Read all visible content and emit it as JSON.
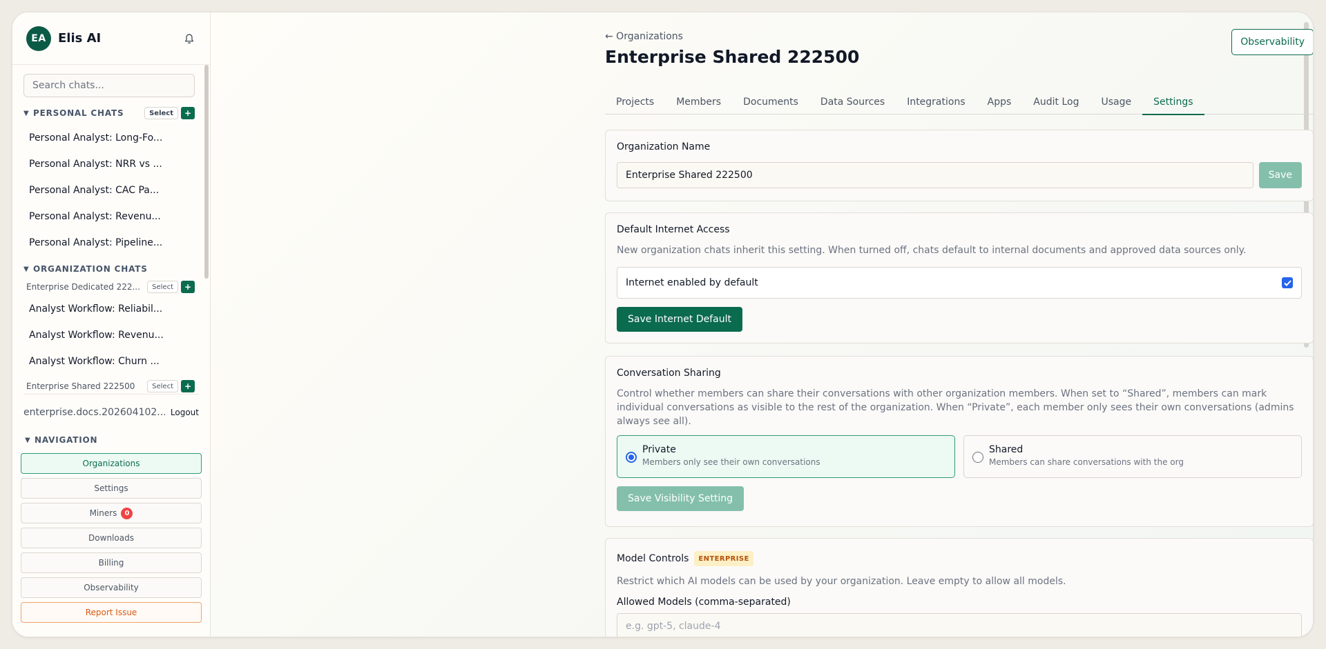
{
  "sidebar": {
    "avatar_initials": "EA",
    "brand": "Elis AI",
    "search_placeholder": "Search chats...",
    "personal_section": {
      "caret": "▼",
      "title": "PERSONAL CHATS",
      "select_label": "Select",
      "plus_label": "+",
      "items": [
        "Personal Analyst: Long-Fo...",
        "Personal Analyst: NRR vs ...",
        "Personal Analyst: CAC Pa...",
        "Personal Analyst: Revenu...",
        "Personal Analyst: Pipeline..."
      ]
    },
    "org_section": {
      "caret": "▼",
      "title": "ORGANIZATION CHATS",
      "orgs": [
        {
          "name": "Enterprise Dedicated 222...",
          "select_label": "Select",
          "plus_label": "+",
          "items": [
            "Analyst Workflow: Reliabil...",
            "Analyst Workflow: Revenu...",
            "Analyst Workflow: Churn ..."
          ]
        },
        {
          "name": "Enterprise Shared 222500",
          "select_label": "Select",
          "plus_label": "+"
        }
      ]
    },
    "user": {
      "email": "enterprise.docs.202604102...",
      "logout_label": "Logout"
    },
    "navigation": {
      "caret": "▼",
      "title": "NAVIGATION",
      "items": [
        {
          "label": "Organizations"
        },
        {
          "label": "Settings"
        },
        {
          "label": "Miners",
          "badge": "0"
        },
        {
          "label": "Downloads"
        },
        {
          "label": "Billing"
        },
        {
          "label": "Observability"
        },
        {
          "label": "Report Issue"
        }
      ]
    }
  },
  "main": {
    "back_link": "← Organizations",
    "title": "Enterprise Shared 222500",
    "observability_button": "Observability",
    "tabs": [
      {
        "label": "Projects"
      },
      {
        "label": "Members"
      },
      {
        "label": "Documents"
      },
      {
        "label": "Data Sources"
      },
      {
        "label": "Integrations"
      },
      {
        "label": "Apps"
      },
      {
        "label": "Audit Log"
      },
      {
        "label": "Usage"
      },
      {
        "label": "Settings",
        "active": true
      }
    ],
    "org_name_card": {
      "title": "Organization Name",
      "value": "Enterprise Shared 222500",
      "save_label": "Save"
    },
    "internet_card": {
      "title": "Default Internet Access",
      "description": "New organization chats inherit this setting. When turned off, chats default to internal documents and approved data sources only.",
      "toggle_label": "Internet enabled by default",
      "checked": true,
      "save_label": "Save Internet Default"
    },
    "sharing_card": {
      "title": "Conversation Sharing",
      "description": "Control whether members can share their conversations with other organization members. When set to “Shared”, members can mark individual conversations as visible to the rest of the organization. When “Private”, each member only sees their own conversations (admins always see all).",
      "options": [
        {
          "label": "Private",
          "sub": "Members only see their own conversations",
          "selected": true
        },
        {
          "label": "Shared",
          "sub": "Members can share conversations with the org",
          "selected": false
        }
      ],
      "save_label": "Save Visibility Setting"
    },
    "model_card": {
      "title": "Model Controls",
      "badge": "ENTERPRISE",
      "description": "Restrict which AI models can be used by your organization. Leave empty to allow all models.",
      "field_label": "Allowed Models (comma-separated)",
      "placeholder": "e.g. gpt-5, claude-4"
    }
  },
  "colors": {
    "brand": "#0b6b4f",
    "brand_disabled": "#84bfac",
    "danger": "#ef4444",
    "warning_text": "#dd5a12",
    "enterprise_badge_bg": "#fdf0c6"
  }
}
